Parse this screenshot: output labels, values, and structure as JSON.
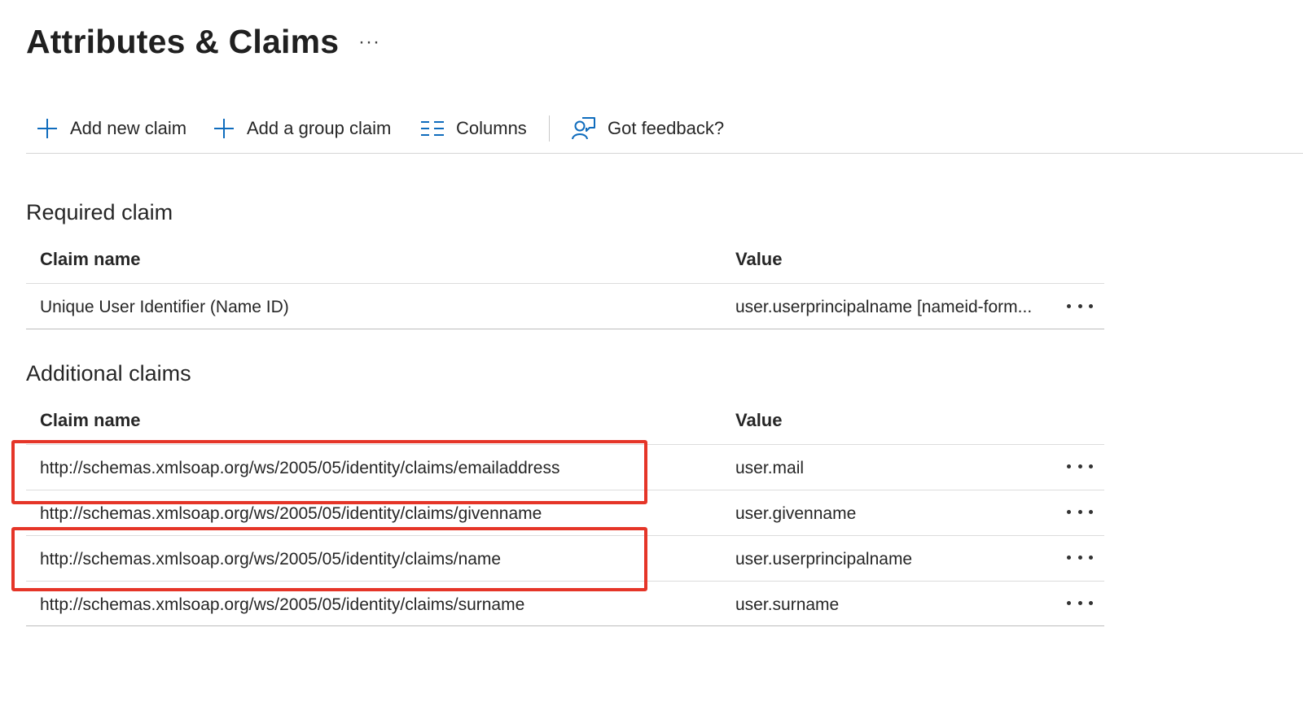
{
  "page": {
    "title": "Attributes & Claims",
    "more_label": "···"
  },
  "toolbar": {
    "add_new_claim": "Add new claim",
    "add_group_claim": "Add a group claim",
    "columns": "Columns",
    "feedback": "Got feedback?"
  },
  "required": {
    "section_title": "Required claim",
    "col_name": "Claim name",
    "col_value": "Value",
    "rows": [
      {
        "name": "Unique User Identifier (Name ID)",
        "value": "user.userprincipalname [nameid-form..."
      }
    ]
  },
  "additional": {
    "section_title": "Additional claims",
    "col_name": "Claim name",
    "col_value": "Value",
    "rows": [
      {
        "name": "http://schemas.xmlsoap.org/ws/2005/05/identity/claims/emailaddress",
        "value": "user.mail",
        "highlighted": true
      },
      {
        "name": "http://schemas.xmlsoap.org/ws/2005/05/identity/claims/givenname",
        "value": "user.givenname",
        "highlighted": false
      },
      {
        "name": "http://schemas.xmlsoap.org/ws/2005/05/identity/claims/name",
        "value": "user.userprincipalname",
        "highlighted": true
      },
      {
        "name": "http://schemas.xmlsoap.org/ws/2005/05/identity/claims/surname",
        "value": "user.surname",
        "highlighted": false
      }
    ]
  },
  "colors": {
    "accent": "#0f6cbd",
    "highlight": "#e53528"
  }
}
